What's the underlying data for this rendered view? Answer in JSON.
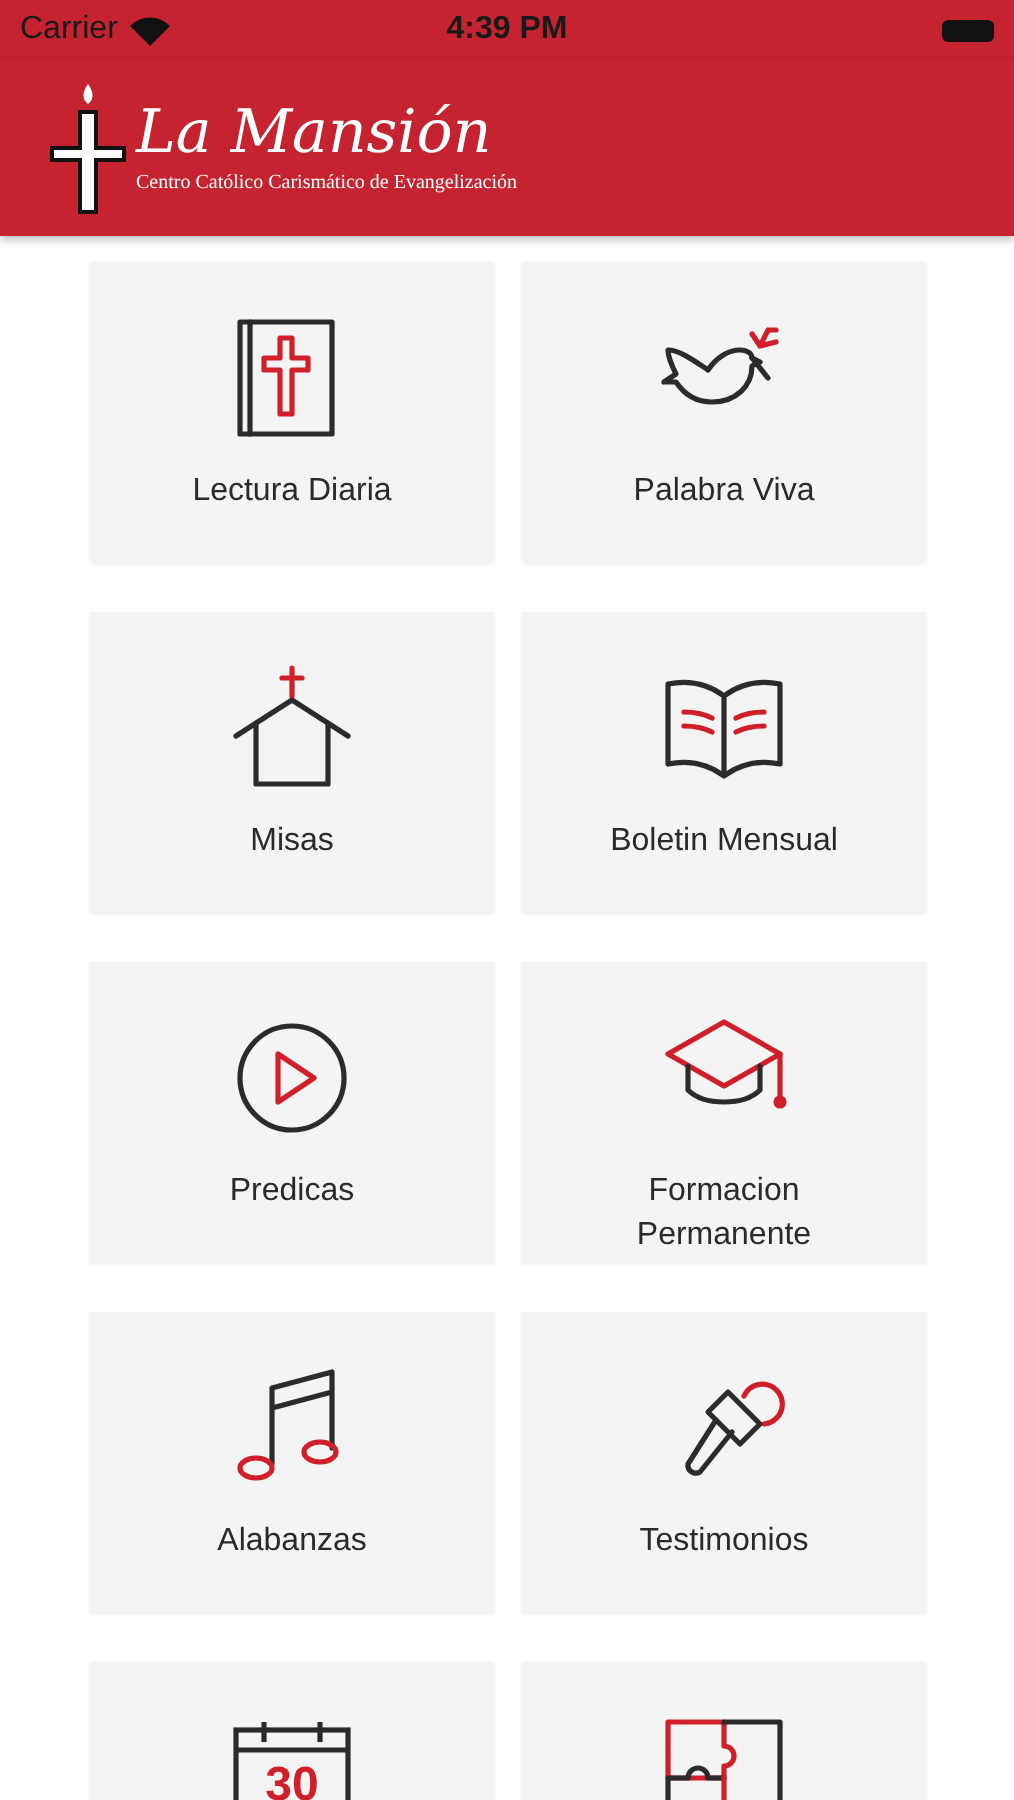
{
  "status_bar": {
    "carrier": "Carrier",
    "time": "4:39 PM"
  },
  "header": {
    "title": "La Mansión",
    "subtitle": "Centro Católico Carismático de Evangelización"
  },
  "tiles": [
    {
      "label": "Lectura Diaria",
      "kind": "bible"
    },
    {
      "label": "Palabra Viva",
      "kind": "dove"
    },
    {
      "label": "Misas",
      "kind": "church"
    },
    {
      "label": "Boletin Mensual",
      "kind": "book"
    },
    {
      "label": "Predicas",
      "kind": "play"
    },
    {
      "label": "Formacion Permanente",
      "kind": "cap"
    },
    {
      "label": "Alabanzas",
      "kind": "music"
    },
    {
      "label": "Testimonios",
      "kind": "microphone"
    },
    {
      "kind": "calendar",
      "icon_text": "30"
    },
    {
      "kind": "puzzle"
    }
  ]
}
